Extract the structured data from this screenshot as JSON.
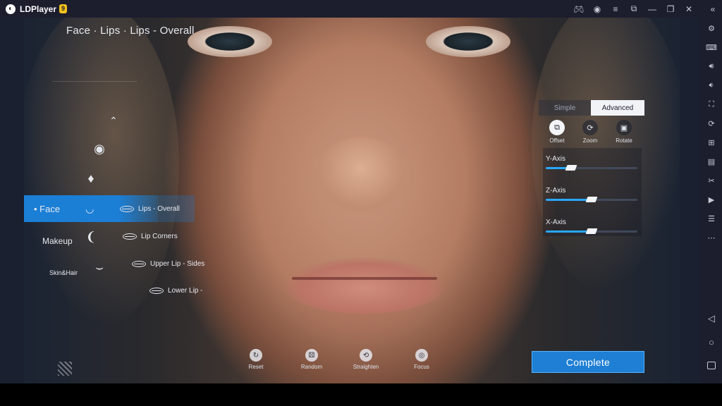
{
  "app": {
    "name": "LDPlayer",
    "version_badge": "9"
  },
  "window_controls": [
    "gamepad-icon",
    "account-icon",
    "menu-icon",
    "popout-icon",
    "minimize-icon",
    "restore-icon",
    "close-icon",
    "collapse-icon"
  ],
  "breadcrumb": "Face · Lips · Lips - Overall",
  "categories": {
    "face": "Face",
    "makeup": "Makeup",
    "skin_hair": "Skin&Hair"
  },
  "face_parts": [
    "brow-icon",
    "eye-icon",
    "nose-icon",
    "lips-icon",
    "ear-icon",
    "jaw-icon"
  ],
  "lip_options": [
    {
      "label": "Lips - Overall"
    },
    {
      "label": "Lip Corners"
    },
    {
      "label": "Upper Lip - Sides"
    },
    {
      "label": "Lower Lip -"
    }
  ],
  "mode_tabs": {
    "simple": "Simple",
    "advanced": "Advanced"
  },
  "tools": {
    "offset": "Offset",
    "zoom": "Zoom",
    "rotate": "Rotate"
  },
  "sliders": [
    {
      "label": "Y-Axis",
      "value": 0.28
    },
    {
      "label": "Z-Axis",
      "value": 0.5
    },
    {
      "label": "X-Axis",
      "value": 0.5
    }
  ],
  "bottom_tools": {
    "reset": "Reset",
    "random": "Random",
    "straighten": "Straighten",
    "focus": "Focus"
  },
  "complete_label": "Complete",
  "colors": {
    "accent": "#1f7fd4",
    "slider_fill": "#28a8ff",
    "chrome": "#1c1e2e"
  }
}
